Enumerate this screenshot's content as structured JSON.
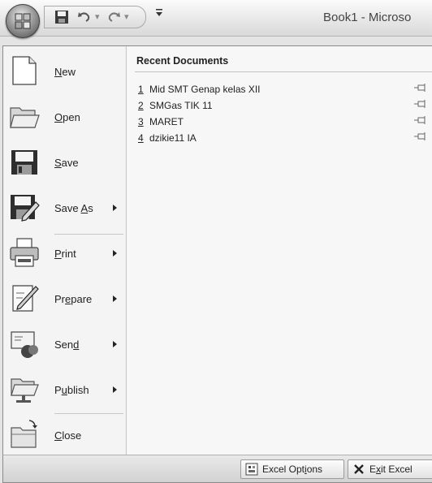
{
  "window": {
    "title": "Book1 - Microso"
  },
  "quick_access": {
    "items": [
      {
        "icon": "save-icon"
      },
      {
        "icon": "undo-icon"
      },
      {
        "icon": "redo-icon"
      },
      {
        "icon": "customize-dropdown-icon"
      }
    ]
  },
  "menu": {
    "items": [
      {
        "icon": "new-document-icon",
        "pre": "",
        "key": "N",
        "post": "ew",
        "submenu": false
      },
      {
        "icon": "open-folder-icon",
        "pre": "",
        "key": "O",
        "post": "pen",
        "submenu": false
      },
      {
        "icon": "floppy-disk-icon",
        "pre": "",
        "key": "S",
        "post": "ave",
        "submenu": false
      },
      {
        "icon": "save-as-icon",
        "pre": "Save ",
        "key": "A",
        "post": "s",
        "submenu": true
      },
      {
        "icon": "printer-icon",
        "pre": "",
        "key": "P",
        "post": "rint",
        "submenu": true
      },
      {
        "icon": "prepare-icon",
        "pre": "Pr",
        "key": "e",
        "post": "pare",
        "submenu": true
      },
      {
        "icon": "send-icon",
        "pre": "Sen",
        "key": "d",
        "post": "",
        "submenu": true
      },
      {
        "icon": "publish-icon",
        "pre": "P",
        "key": "u",
        "post": "blish",
        "submenu": true
      },
      {
        "icon": "close-folder-icon",
        "pre": "",
        "key": "C",
        "post": "lose",
        "submenu": false
      }
    ]
  },
  "recent": {
    "header": "Recent Documents",
    "items": [
      {
        "num": "1",
        "name": "Mid SMT Genap kelas XII"
      },
      {
        "num": "2",
        "name": "SMGas TIK 11"
      },
      {
        "num": "3",
        "name": "MARET"
      },
      {
        "num": "4",
        "name": "dzikie11 IA"
      }
    ]
  },
  "footer": {
    "options": {
      "pre": "Excel Opt",
      "key": "i",
      "post": "ons"
    },
    "exit": {
      "pre": "E",
      "key": "x",
      "post": "it Excel"
    }
  }
}
